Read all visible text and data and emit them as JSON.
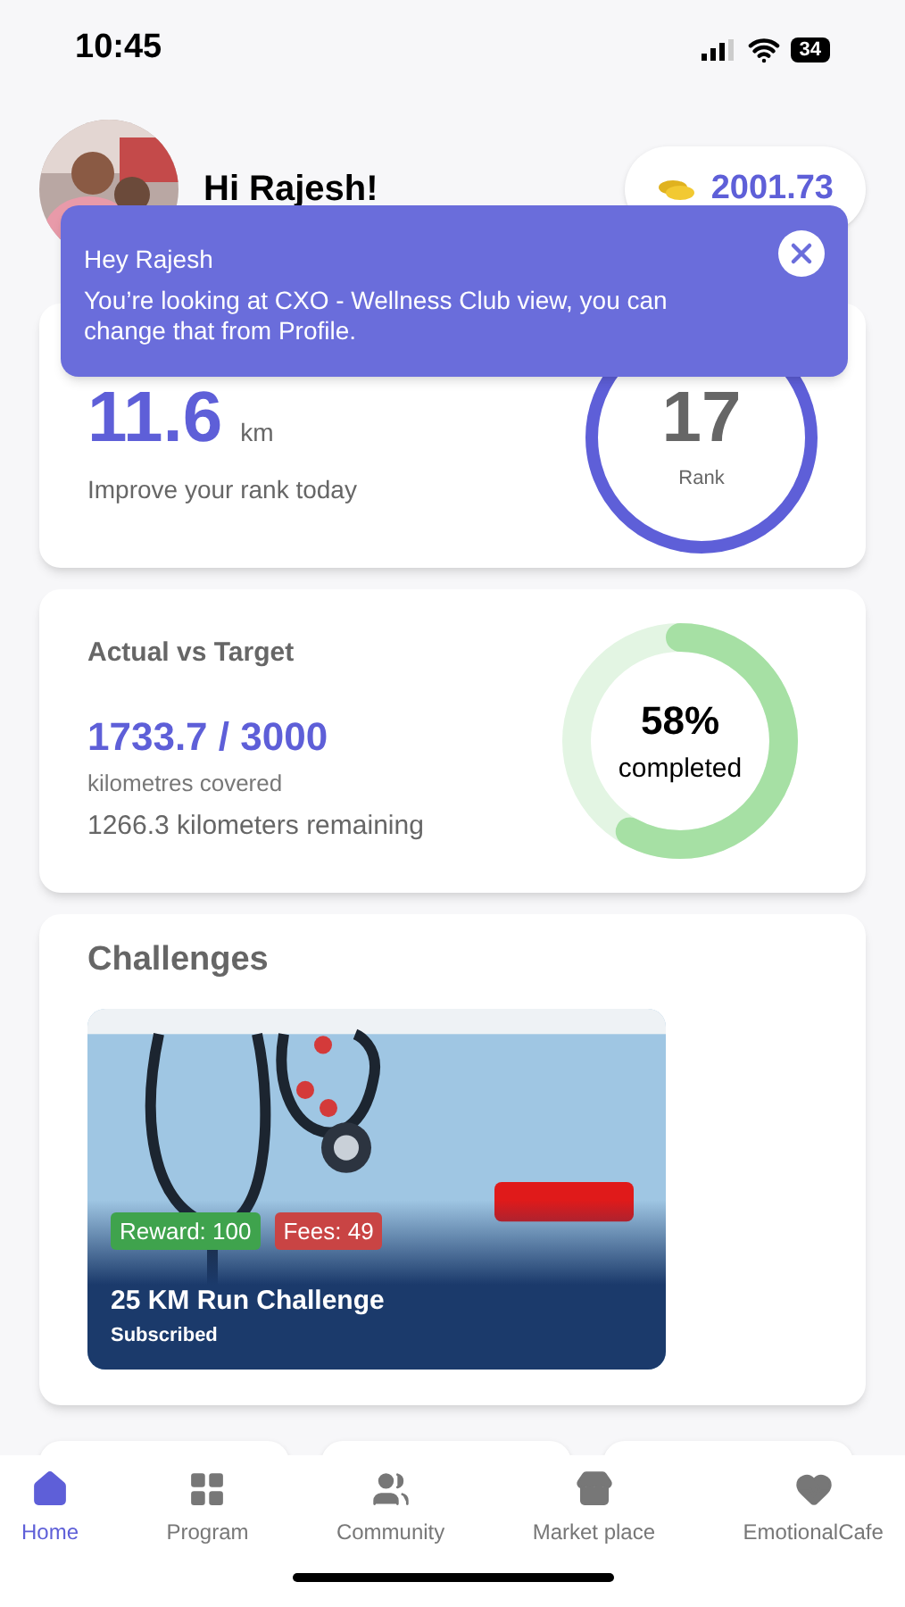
{
  "status_bar": {
    "time": "10:45",
    "battery": "34"
  },
  "header": {
    "greeting": "Hi Rajesh!",
    "coins": "2001.73"
  },
  "tooltip": {
    "title": "Hey Rajesh",
    "message": "You’re looking at CXO - Wellness Club view, you can change that from Profile."
  },
  "rank_card": {
    "distance": "11.6",
    "unit": "km",
    "subtitle": "Improve your rank today",
    "rank": "17",
    "rank_label": "Rank"
  },
  "target_card": {
    "title": "Actual vs Target",
    "progress": "1733.7 / 3000",
    "progress_label": "kilometres covered",
    "remaining": "1266.3 kilometers remaining",
    "percent": "58%",
    "percent_label": "completed"
  },
  "challenges": {
    "title": "Challenges",
    "items": [
      {
        "reward": "Reward: 100",
        "fees": "Fees: 49",
        "name": "25 KM Run Challenge",
        "status": "Subscribed"
      }
    ]
  },
  "nav": [
    {
      "label": "Home",
      "kind": "home",
      "selected": true
    },
    {
      "label": "Program",
      "kind": "grid",
      "selected": false
    },
    {
      "label": "Community",
      "kind": "people",
      "selected": false
    },
    {
      "label": "Market place",
      "kind": "store",
      "selected": false
    },
    {
      "label": "EmotionalCafe",
      "kind": "heart",
      "selected": false
    }
  ]
}
